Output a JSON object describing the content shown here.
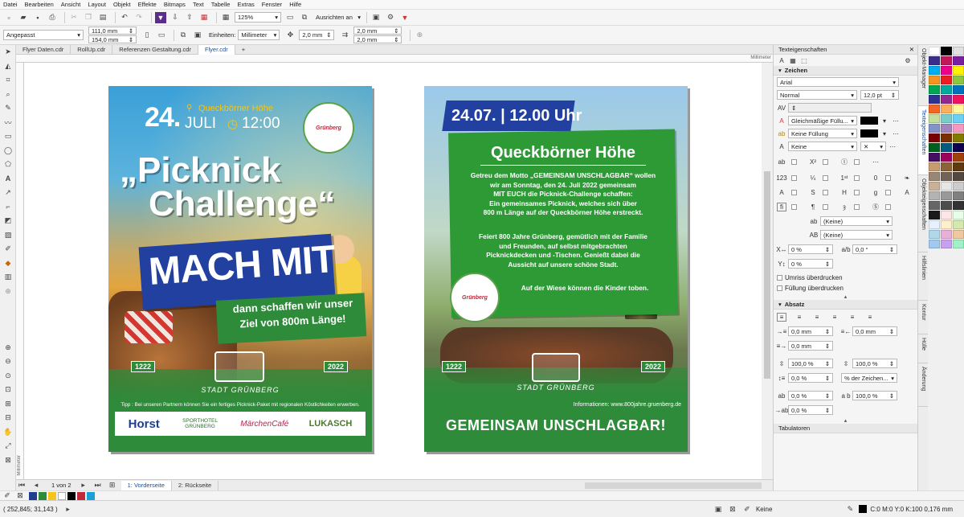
{
  "menu": [
    "Datei",
    "Bearbeiten",
    "Ansicht",
    "Layout",
    "Objekt",
    "Effekte",
    "Bitmaps",
    "Text",
    "Tabelle",
    "Extras",
    "Fenster",
    "Hilfe"
  ],
  "toolbar": {
    "zoom": "125%",
    "align_label": "Ausrichten an",
    "size_preset": "Angepasst",
    "width": "111,0 mm",
    "height": "154,0 mm",
    "units_label": "Einheiten:",
    "units": "Millimeter",
    "nudge": "2,0 mm",
    "dup_x": "2,0 mm",
    "dup_y": "2,0 mm"
  },
  "tabs": [
    "Flyer Daten.cdr",
    "RollUp.cdr",
    "Referenzen Gestaltung.cdr",
    "Flyer.cdr"
  ],
  "ruler_unit": "Millimeter",
  "ruler_left_unit": "Millimeter",
  "poster1": {
    "date_day": "24.",
    "date_month": "JULI",
    "time": "12:00",
    "location": "Queckbörner Höhe",
    "title_line1": "„Picknick",
    "title_line2": "Challenge“",
    "cta": "MACH MIT",
    "sub_line1": "dann schaffen wir unser",
    "sub_line2": "Ziel von 800m Länge!",
    "year_left": "1222",
    "year_right": "2022",
    "seal_text": "Grünberg",
    "town": "STADT GRÜNBERG",
    "tip": "Tipp : Bei unseren Partnern können Sie ein fertiges Picknick-Paket mit regionalen Köstlichkeiten erwerben.",
    "sponsors": [
      "Horst",
      "SPORTHOTEL GRÜNBERG",
      "MärchenCafé",
      "LUKASCH"
    ]
  },
  "poster2": {
    "datetime": "24.07. | 12.00 Uhr",
    "headline": "Queckbörner Höhe",
    "para1": [
      "Getreu dem Motto „GEMEINSAM UNSCHLAGBAR“ wollen",
      "wir am Sonntag, den 24. Juli 2022 gemeinsam",
      "MIT EUCH die Picknick-Challenge schaffen:",
      "Ein gemeinsames Picknick, welches sich über",
      "800 m Länge auf der Queckbörner Höhe erstreckt."
    ],
    "para2": [
      "Feiert 800 Jahre Grünberg, gemütlich mit der Familie",
      "und Freunden, auf selbst mitgebrachten",
      "Picknickdecken und -Tischen. Genießt dabei die",
      "Aussicht auf unsere schöne Stadt."
    ],
    "para3": "Auf der Wiese können die Kinder toben.",
    "year_left": "1222",
    "year_right": "2022",
    "seal_text": "Grünberg",
    "town": "STADT GRÜNBERG",
    "info": "Informationen:  www.800jahre.gruenberg.de",
    "slogan": "GEMEINSAM UNSCHLAGBAR!"
  },
  "page_nav": {
    "counter": "1 von 2",
    "page1": "1: Vorderseite",
    "page2": "2: Rückseite"
  },
  "panel": {
    "title": "Texteigenschaften",
    "zeichen": "Zeichen",
    "font": "Arial",
    "style": "Normal",
    "size": "12,0 pt",
    "fill": "Gleichmäßige Füllu...",
    "bg_fill": "Keine Füllung",
    "outline": "Keine",
    "keine1": "(Keine)",
    "keine2": "(Keine)",
    "kern": "0 %",
    "angle": "0,0 °",
    "shift": "0 %",
    "umriss": "Umriss überdrucken",
    "fuellung": "Füllung überdrucken",
    "absatz": "Absatz",
    "indent1": "0,0 mm",
    "indent2": "0,0 mm",
    "indent3": "0,0 mm",
    "spacing1": "100,0 %",
    "spacing2": "100,0 %",
    "spacing3": "0,0 %",
    "line_unit": "% der Zeichen...",
    "spacing4": "0,0 %",
    "spacing5": "100,0 %",
    "spacing6": "0,0 %",
    "tabulatoren": "Tabulatoren"
  },
  "dock_tabs": [
    "Objekt-Manager",
    "Texteigenschaften",
    "Objekteigenschaften",
    "Hilfslinien",
    "Kontur",
    "Hülle",
    "Änderung"
  ],
  "status": {
    "coords": "( 252,845; 31,143 )",
    "fill_none": "Keine",
    "color_info": "C:0 M:0 Y:0 K:100  0,176 mm"
  },
  "colors": {
    "accent": "#1a4f9c",
    "green": "#2e8b3a",
    "blue": "#2140a0"
  }
}
